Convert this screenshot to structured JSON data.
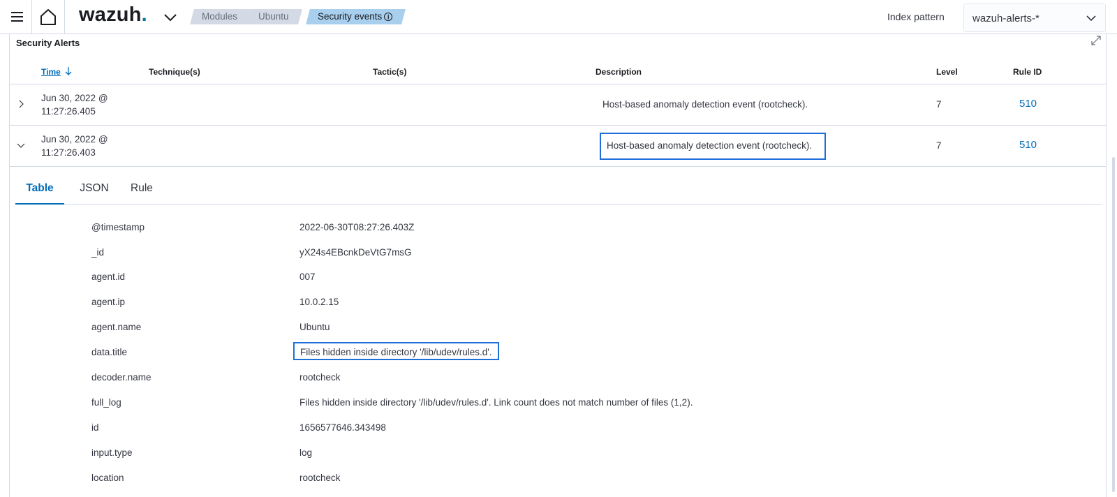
{
  "header": {
    "logo_text": "wazuh",
    "logo_dot": ".",
    "breadcrumbs": [
      "Modules",
      "Ubuntu",
      "Security events"
    ],
    "index_pattern_label": "Index pattern",
    "index_pattern_value": "wazuh-alerts-*"
  },
  "panel": {
    "title": "Security Alerts",
    "columns": {
      "time": "Time",
      "techniques": "Technique(s)",
      "tactics": "Tactic(s)",
      "description": "Description",
      "level": "Level",
      "rule_id": "Rule ID"
    },
    "rows": [
      {
        "time_line1": "Jun 30, 2022 @",
        "time_line2": "11:27:26.405",
        "description": "Host-based anomaly detection event (rootcheck).",
        "level": "7",
        "rule_id": "510"
      },
      {
        "time_line1": "Jun 30, 2022 @",
        "time_line2": "11:27:26.403",
        "description": "Host-based anomaly detection event (rootcheck).",
        "level": "7",
        "rule_id": "510"
      }
    ]
  },
  "details": {
    "tabs": [
      "Table",
      "JSON",
      "Rule"
    ],
    "fields": [
      {
        "key": "@timestamp",
        "value": "2022-06-30T08:27:26.403Z"
      },
      {
        "key": "_id",
        "value": "yX24s4EBcnkDeVtG7msG"
      },
      {
        "key": "agent.id",
        "value": "007"
      },
      {
        "key": "agent.ip",
        "value": "10.0.2.15"
      },
      {
        "key": "agent.name",
        "value": "Ubuntu"
      },
      {
        "key": "data.title",
        "value": "Files hidden inside directory '/lib/udev/rules.d'."
      },
      {
        "key": "decoder.name",
        "value": "rootcheck"
      },
      {
        "key": "full_log",
        "value": "Files hidden inside directory '/lib/udev/rules.d'. Link count does not match number of files (1,2)."
      },
      {
        "key": "id",
        "value": "1656577646.343498"
      },
      {
        "key": "input.type",
        "value": "log"
      },
      {
        "key": "location",
        "value": "rootcheck"
      }
    ]
  },
  "colors": {
    "accent": "#006bb8",
    "highlight_box": "#1e6fd9",
    "breadcrumb_active": "#a9cfee",
    "breadcrumb": "#d3dae6"
  },
  "icons": [
    "menu-icon",
    "home-icon",
    "chevron-down-icon",
    "info-icon",
    "expand-icon",
    "sort-down-icon",
    "chevron-right-icon"
  ]
}
